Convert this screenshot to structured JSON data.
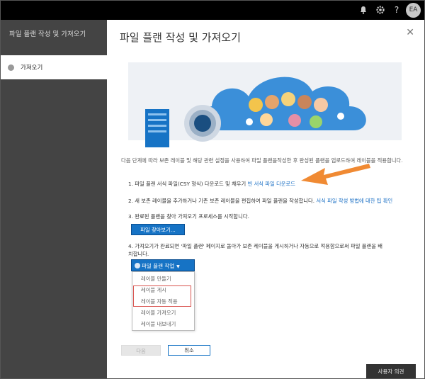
{
  "topbar": {
    "icons": [
      "bell-icon",
      "gear-icon",
      "help-icon"
    ],
    "avatar_initials": "EA"
  },
  "rail": {
    "title": "파일 플랜 작성 및 가져오기",
    "item": "가져오기"
  },
  "main": {
    "title": "파일 플랜 작성 및 가져오기",
    "intro": "다음 단계에 따라 보존 레이블 및 해당 관련 설정을 사용하여 파일 플랜을작성한 후 완성된 플랜을 업로드하여 레이블을 적용합니다.",
    "step1_text": "1. 파일 플랜 서식 파일(CSY 형식) 다운로드 및 채우기 ",
    "step1_link": "빈 서식 파일 다운로드",
    "step2_text": "2. 새 보존 레이블을 추가하거나 기존 보존 레이블을 편집하여 파일 플랜을 작성합니다. ",
    "step2_link": "서식 파일 작성 방법에 대한 팁 확인",
    "step3_text": "3. 완료된 플랜을 찾아 가져오기 프로세스를 시작합니다.",
    "browse_button": "파일 찾아보기...",
    "step4_text": "4. 가져오기가 완료되면 '파일 플랜' 페이지로 돌아가 보존 레이블을 게시하거나 자동으로 적용함으로써 파일 플랜을 배치합니다.",
    "actions_button": "파일 플랜 작업",
    "menu_items": [
      "레이블 만들기",
      "레이블 게시",
      "레이블 자동 적용",
      "레이블 가져오기",
      "레이블 내보내기"
    ],
    "next_button": "다음",
    "cancel_button": "취소",
    "feedback_button": "사용자 의견"
  },
  "colors": {
    "accent": "#1673c5",
    "arrow": "#f08a33",
    "highlight": "#d9534f",
    "rail": "#444444",
    "topbar": "#000000"
  }
}
